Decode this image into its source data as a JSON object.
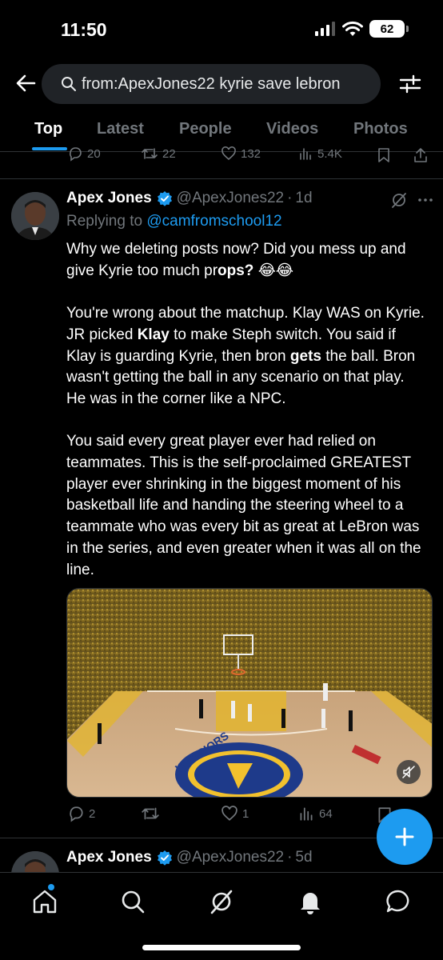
{
  "status_bar": {
    "time": "11:50",
    "battery": "62"
  },
  "search": {
    "query": "from:ApexJones22 kyrie save lebron"
  },
  "tabs": [
    {
      "label": "Top"
    },
    {
      "label": "Latest"
    },
    {
      "label": "People"
    },
    {
      "label": "Videos"
    },
    {
      "label": "Photos"
    }
  ],
  "prev_post_actions": {
    "replies": "20",
    "reposts": "22",
    "likes": "132",
    "views": "5.4K"
  },
  "post": {
    "display_name": "Apex Jones",
    "handle": "@ApexJones22",
    "separator": "·",
    "time": "1d",
    "replying_prefix": "Replying to ",
    "replying_to": "@camfromschool12",
    "para1_a": "Why we deleting posts now?  Did you mess up and give Kyrie too much pr",
    "para1_b": "ops?",
    "para1_emoji": " 😂😂",
    "para2_a": "You're wrong about the matchup. Klay WAS on Kyrie. JR picked ",
    "para2_b": "Klay",
    "para2_c": " to make Steph switch. You said if Klay is guarding Kyrie, then bron ",
    "para2_d": "gets",
    "para2_e": " the ball. Bron wasn't getting the ball in any scenario on that play. He was in the corner like a NPC.",
    "para3": "You said every great player ever had relied on teammates. This is the self-proclaimed GREATEST player ever shrinking in the biggest moment of his basketball life and handing the steering wheel to a teammate who was every bit as great at LeBron was in the series, and even greater when it was all on the line.",
    "actions": {
      "replies": "2",
      "reposts": "",
      "likes": "1",
      "views": "64"
    }
  },
  "next_post": {
    "display_name": "Apex Jones",
    "handle": "@ApexJones22",
    "separator": "·",
    "time": "5d"
  },
  "colors": {
    "accent": "#1d9bf0",
    "background": "#000000",
    "muted": "#71767b"
  }
}
